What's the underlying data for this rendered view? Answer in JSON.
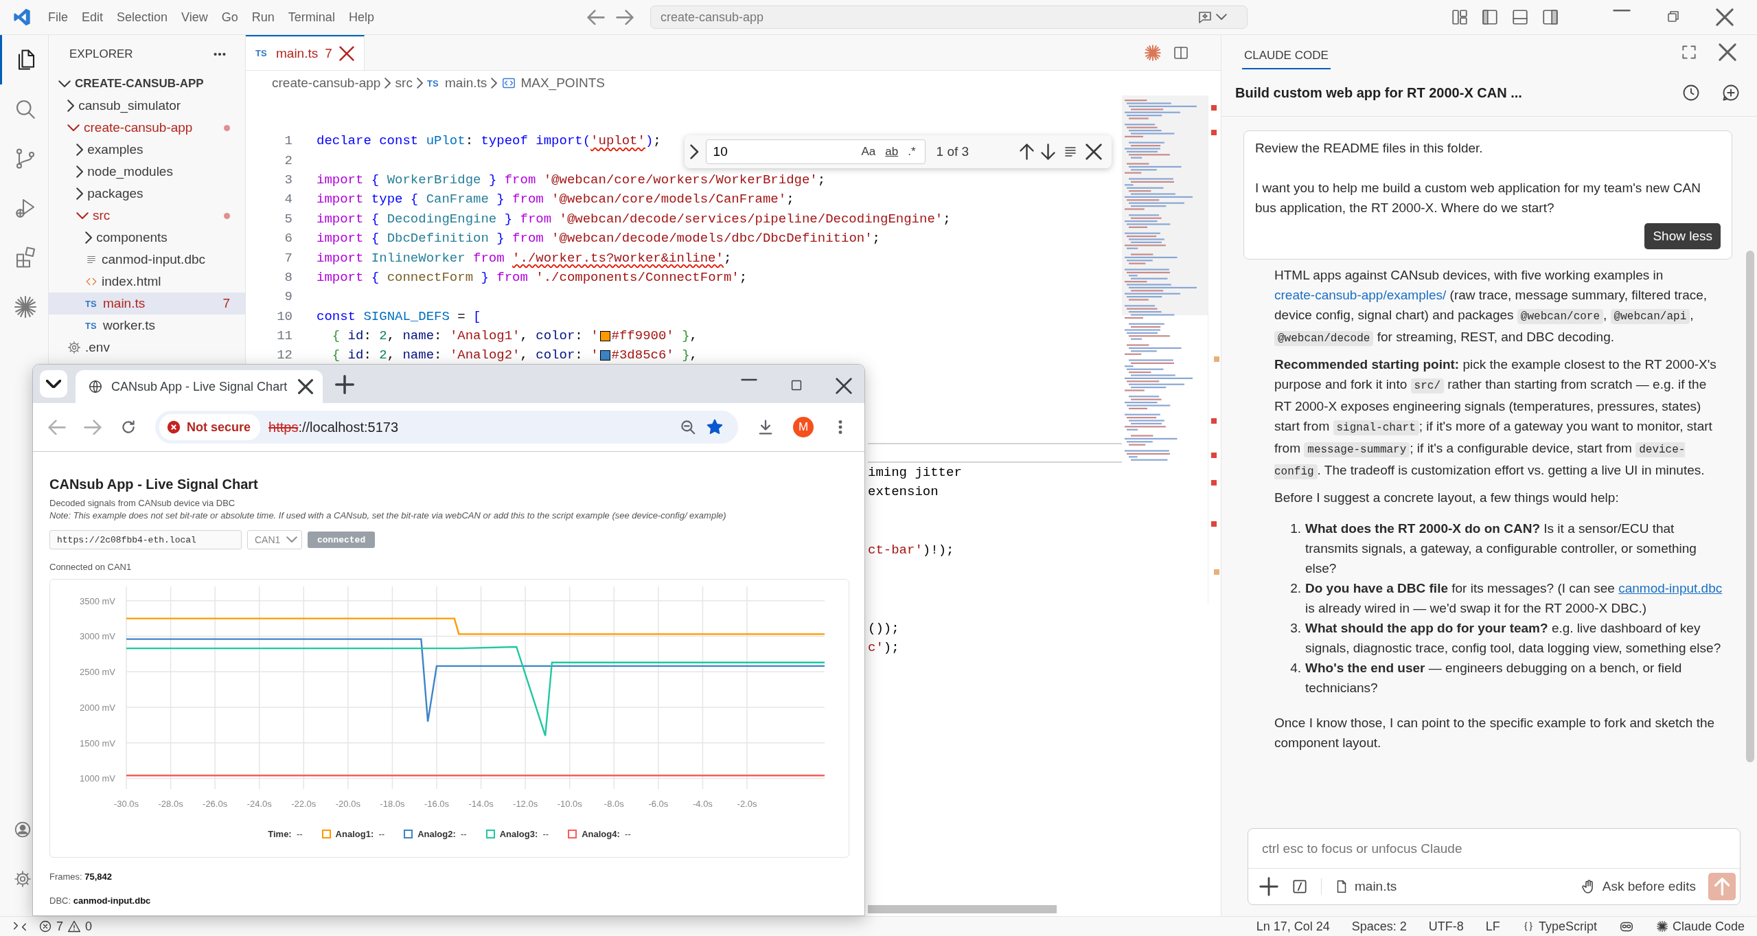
{
  "title_bar": {
    "menu": [
      "File",
      "Edit",
      "Selection",
      "View",
      "Go",
      "Run",
      "Terminal",
      "Help"
    ],
    "command_center": "create-cansub-app"
  },
  "activity_bar": [
    {
      "kind": "files",
      "selected": true
    },
    {
      "kind": "search",
      "selected": false
    },
    {
      "kind": "source_control",
      "selected": false
    },
    {
      "kind": "run_debug",
      "selected": false
    },
    {
      "kind": "extensions",
      "selected": false
    },
    {
      "kind": "claude",
      "selected": false
    }
  ],
  "activity_bar_bottom": [
    {
      "kind": "account"
    },
    {
      "kind": "settings"
    }
  ],
  "explorer": {
    "title": "EXPLORER",
    "tree": [
      {
        "label": "CREATE-CANSUB-APP",
        "kind": "root",
        "expanded": true,
        "selected": false,
        "error": false,
        "children": [
          {
            "label": "cansub_simulator",
            "kind": "folder",
            "expanded": false,
            "selected": false,
            "error": false
          },
          {
            "label": "create-cansub-app",
            "kind": "folder",
            "expanded": true,
            "selected": false,
            "error": true,
            "children": [
              {
                "label": "examples",
                "kind": "folder",
                "expanded": false,
                "selected": false,
                "error": false
              },
              {
                "label": "node_modules",
                "kind": "folder",
                "expanded": false,
                "selected": false,
                "error": false
              },
              {
                "label": "packages",
                "kind": "folder",
                "expanded": false,
                "selected": false,
                "error": false
              },
              {
                "label": "src",
                "kind": "folder",
                "expanded": true,
                "selected": false,
                "error": true,
                "children": [
                  {
                    "label": "components",
                    "kind": "folder",
                    "expanded": false,
                    "selected": false,
                    "error": false
                  },
                  {
                    "label": "canmod-input.dbc",
                    "kind": "text_file",
                    "selected": false,
                    "error": false
                  },
                  {
                    "label": "index.html",
                    "kind": "html_file",
                    "selected": false,
                    "error": false
                  },
                  {
                    "label": "main.ts",
                    "kind": "ts_file",
                    "tag": "TS",
                    "badge": "7",
                    "selected": true,
                    "error": true
                  },
                  {
                    "label": "worker.ts",
                    "kind": "ts_file",
                    "tag": "TS",
                    "selected": false,
                    "error": false
                  }
                ]
              }
            ]
          },
          {
            "label": ".env",
            "kind": "config_file",
            "selected": false,
            "error": false
          }
        ]
      }
    ]
  },
  "editor": {
    "tabs": [
      {
        "tag": "TS",
        "label": "main.ts",
        "badge": "7",
        "selected": true
      }
    ],
    "breadcrumbs": [
      {
        "kind": "folder",
        "label": "create-cansub-app"
      },
      {
        "kind": "folder",
        "label": "src"
      },
      {
        "kind": "ts_file",
        "tag": "TS",
        "label": "main.ts"
      },
      {
        "kind": "symbol",
        "label": "MAX_POINTS"
      }
    ],
    "find": {
      "value": "10",
      "options": [
        {
          "label": "Aa",
          "on": false
        },
        {
          "label": "ab",
          "on": false
        },
        {
          "label": ".*",
          "on": false
        }
      ],
      "result": "1 of 3"
    },
    "lines": [
      {
        "n": "1",
        "current": false,
        "tokens": [
          {
            "kind": "kw",
            "text": "declare const "
          },
          {
            "kind": "var",
            "text": "uPlot"
          },
          {
            "kind": "p",
            "text": ": "
          },
          {
            "kind": "kw",
            "text": "typeof import"
          },
          {
            "kind": "br",
            "text": "("
          },
          {
            "kind": "str",
            "text": "'uplot'",
            "squiggle": true
          },
          {
            "kind": "br",
            "text": ")"
          },
          {
            "kind": "p",
            "text": ";"
          }
        ]
      },
      {
        "n": "2",
        "current": false
      },
      {
        "n": "3",
        "current": false,
        "tokens": [
          {
            "kind": "ctl",
            "text": "import "
          },
          {
            "kind": "br",
            "text": "{ "
          },
          {
            "kind": "cls",
            "text": "WorkerBridge "
          },
          {
            "kind": "br",
            "text": "} "
          },
          {
            "kind": "ctl",
            "text": "from "
          },
          {
            "kind": "str",
            "text": "'@webcan/core/workers/WorkerBridge'"
          },
          {
            "kind": "p",
            "text": ";"
          }
        ]
      },
      {
        "n": "4",
        "current": false,
        "tokens": [
          {
            "kind": "ctl",
            "text": "import "
          },
          {
            "kind": "kw",
            "text": "type "
          },
          {
            "kind": "br",
            "text": "{ "
          },
          {
            "kind": "cls",
            "text": "CanFrame "
          },
          {
            "kind": "br",
            "text": "} "
          },
          {
            "kind": "ctl",
            "text": "from "
          },
          {
            "kind": "str",
            "text": "'@webcan/core/models/CanFrame'"
          },
          {
            "kind": "p",
            "text": ";"
          }
        ]
      },
      {
        "n": "5",
        "current": false,
        "tokens": [
          {
            "kind": "ctl",
            "text": "import "
          },
          {
            "kind": "br",
            "text": "{ "
          },
          {
            "kind": "cls",
            "text": "DecodingEngine "
          },
          {
            "kind": "br",
            "text": "} "
          },
          {
            "kind": "ctl",
            "text": "from "
          },
          {
            "kind": "str",
            "text": "'@webcan/decode/services/pipeline/DecodingEngine'"
          },
          {
            "kind": "p",
            "text": ";"
          }
        ]
      },
      {
        "n": "6",
        "current": false,
        "tokens": [
          {
            "kind": "ctl",
            "text": "import "
          },
          {
            "kind": "br",
            "text": "{ "
          },
          {
            "kind": "cls",
            "text": "DbcDefinition "
          },
          {
            "kind": "br",
            "text": "} "
          },
          {
            "kind": "ctl",
            "text": "from "
          },
          {
            "kind": "str",
            "text": "'@webcan/decode/models/dbc/DbcDefinition'"
          },
          {
            "kind": "p",
            "text": ";"
          }
        ]
      },
      {
        "n": "7",
        "current": false,
        "tokens": [
          {
            "kind": "ctl",
            "text": "import "
          },
          {
            "kind": "cls",
            "text": "InlineWorker "
          },
          {
            "kind": "ctl",
            "text": "from "
          },
          {
            "kind": "str",
            "text": "'./worker.ts?worker&inline'",
            "squiggle": true
          },
          {
            "kind": "p",
            "text": ";"
          }
        ]
      },
      {
        "n": "8",
        "current": false,
        "tokens": [
          {
            "kind": "ctl",
            "text": "import "
          },
          {
            "kind": "br",
            "text": "{ "
          },
          {
            "kind": "fn",
            "text": "connectForm "
          },
          {
            "kind": "br",
            "text": "} "
          },
          {
            "kind": "ctl",
            "text": "from "
          },
          {
            "kind": "str",
            "text": "'./components/ConnectForm'"
          },
          {
            "kind": "p",
            "text": ";"
          }
        ]
      },
      {
        "n": "9",
        "current": false
      },
      {
        "n": "10",
        "current": false,
        "tokens": [
          {
            "kind": "kw",
            "text": "const "
          },
          {
            "kind": "var",
            "text": "SIGNAL_DEFS"
          },
          {
            "kind": "p",
            "text": " = "
          },
          {
            "kind": "br",
            "text": "["
          }
        ]
      },
      {
        "n": "11",
        "current": false,
        "tokens": [
          {
            "kind": "br2",
            "text": "  { "
          },
          {
            "kind": "prop",
            "text": "id"
          },
          {
            "kind": "p",
            "text": ": "
          },
          {
            "kind": "num",
            "text": "2"
          },
          {
            "kind": "p",
            "text": ", "
          },
          {
            "kind": "prop",
            "text": "name"
          },
          {
            "kind": "p",
            "text": ": "
          },
          {
            "kind": "str",
            "text": "'Analog1'"
          },
          {
            "kind": "p",
            "text": ", "
          },
          {
            "kind": "prop",
            "text": "color"
          },
          {
            "kind": "p",
            "text": ": "
          },
          {
            "kind": "str",
            "text": "'"
          },
          {
            "kind": "swatch",
            "color": "#ff9900"
          },
          {
            "kind": "str",
            "text": "#ff9900'"
          },
          {
            "kind": "br2",
            "text": " }"
          },
          {
            "kind": "p",
            "text": ","
          }
        ]
      },
      {
        "n": "12",
        "current": false,
        "tokens": [
          {
            "kind": "br2",
            "text": "  { "
          },
          {
            "kind": "prop",
            "text": "id"
          },
          {
            "kind": "p",
            "text": ": "
          },
          {
            "kind": "num",
            "text": "2"
          },
          {
            "kind": "p",
            "text": ", "
          },
          {
            "kind": "prop",
            "text": "name"
          },
          {
            "kind": "p",
            "text": ": "
          },
          {
            "kind": "str",
            "text": "'Analog2'"
          },
          {
            "kind": "p",
            "text": ", "
          },
          {
            "kind": "prop",
            "text": "color"
          },
          {
            "kind": "p",
            "text": ": "
          },
          {
            "kind": "str",
            "text": "'"
          },
          {
            "kind": "swatch",
            "color": "#3d85c6"
          },
          {
            "kind": "str",
            "text": "#3d85c6'"
          },
          {
            "kind": "br2",
            "text": " }"
          },
          {
            "kind": "p",
            "text": ","
          }
        ]
      }
    ],
    "covered_lines": [
      {
        "kind": "blank",
        "current": false
      },
      {
        "kind": "blank",
        "current": false
      },
      {
        "kind": "blank",
        "current": false
      },
      {
        "kind": "blank",
        "current": false
      },
      {
        "kind": "blank",
        "current": true
      },
      {
        "kind": "code",
        "current": false,
        "tokens": [
          {
            "kind": "p",
            "text": "iming jitter"
          }
        ]
      },
      {
        "kind": "code",
        "current": false,
        "tokens": [
          {
            "kind": "p",
            "text": "extension"
          }
        ]
      },
      {
        "kind": "blank",
        "current": false
      },
      {
        "kind": "blank",
        "current": false
      },
      {
        "kind": "code",
        "current": false,
        "tokens": [
          {
            "kind": "str",
            "text": "ct-bar'"
          },
          {
            "kind": "p",
            "text": ")!);"
          }
        ]
      },
      {
        "kind": "blank",
        "current": false
      },
      {
        "kind": "blank",
        "current": false
      },
      {
        "kind": "blank",
        "current": false
      },
      {
        "kind": "code",
        "current": false,
        "tokens": [
          {
            "kind": "p",
            "text": "());"
          }
        ]
      },
      {
        "kind": "code",
        "current": false,
        "tokens": [
          {
            "kind": "str",
            "text": "c'"
          },
          {
            "kind": "p",
            "text": ");"
          }
        ]
      }
    ]
  },
  "browser": {
    "tab": {
      "title": "CANsub App - Live Signal Chart"
    },
    "security": "Not secure",
    "url": {
      "scheme": "https",
      "rest": "://localhost:5173"
    },
    "bookmarked": true,
    "avatar": "M",
    "page": {
      "title": "CANsub App - Live Signal Chart",
      "subtitle": "Decoded signals from CANsub device via DBC",
      "note": "Note: This example does not set bit-rate or absolute time. If used with a CANsub, set the bit-rate via webCAN or add this to the script example (see device-config/ example)",
      "host": "https://2c08fbb4-eth.local",
      "channel": "CAN1",
      "status_button": "connected",
      "status": "Connected on CAN1",
      "chart_data": {
        "type": "line",
        "grid": true,
        "x": [
          -30,
          -16.7,
          -16.4,
          -16.0,
          -15.2,
          -15.0,
          -12.4,
          -11.1,
          -10.8,
          1.5
        ],
        "series": [
          {
            "color": "#ff9900",
            "values": [
              3250,
              3250,
              3250,
              3250,
              3250,
              3030,
              3030,
              3030,
              3030,
              3030
            ]
          },
          {
            "color": "#3d85c6",
            "values": [
              2960,
              2960,
              1800,
              2580,
              2580,
              2580,
              2580,
              2580,
              2580,
              2580
            ]
          },
          {
            "color": "#1fc8a0",
            "values": [
              2830,
              2830,
              2830,
              2830,
              2830,
              2830,
              2850,
              1600,
              2630,
              2630
            ]
          },
          {
            "color": "#ff5a5a",
            "values": [
              1040,
              1040,
              1040,
              1040,
              1040,
              1040,
              1040,
              1040,
              1040,
              1040
            ]
          }
        ],
        "xlim": [
          -30,
          1.5
        ],
        "ylim": [
          850,
          3700
        ],
        "xticks": [
          {
            "value": -30,
            "label": "-30.0s"
          },
          {
            "value": -28,
            "label": "-28.0s"
          },
          {
            "value": -26,
            "label": "-26.0s"
          },
          {
            "value": -24,
            "label": "-24.0s"
          },
          {
            "value": -22,
            "label": "-22.0s"
          },
          {
            "value": -20,
            "label": "-20.0s"
          },
          {
            "value": -18,
            "label": "-18.0s"
          },
          {
            "value": -16,
            "label": "-16.0s"
          },
          {
            "value": -14,
            "label": "-14.0s"
          },
          {
            "value": -12,
            "label": "-12.0s"
          },
          {
            "value": -10,
            "label": "-10.0s"
          },
          {
            "value": -8,
            "label": "-8.0s"
          },
          {
            "value": -6,
            "label": "-6.0s"
          },
          {
            "value": -4,
            "label": "-4.0s"
          },
          {
            "value": -2,
            "label": "-2.0s"
          }
        ],
        "yticks": [
          {
            "value": 1000,
            "label": "1000 mV"
          },
          {
            "value": 1500,
            "label": "1500 mV"
          },
          {
            "value": 2000,
            "label": "2000 mV"
          },
          {
            "value": 2500,
            "label": "2500 mV"
          },
          {
            "value": 3000,
            "label": "3000 mV"
          },
          {
            "value": 3500,
            "label": "3500 mV"
          }
        ]
      },
      "legend": [
        {
          "kind": "time",
          "label": "Time:",
          "value": "--"
        },
        {
          "kind": "series",
          "label": "Analog1:",
          "value": "--",
          "color": "#ff9900"
        },
        {
          "kind": "series",
          "label": "Analog2:",
          "value": "--",
          "color": "#3d85c6"
        },
        {
          "kind": "series",
          "label": "Analog3:",
          "value": "--",
          "color": "#1fc8a0"
        },
        {
          "kind": "series",
          "label": "Analog4:",
          "value": "--",
          "color": "#ff5a5a"
        }
      ],
      "frames": "Frames: **75,842**",
      "dbc": "DBC: **canmod-input.dbc**"
    }
  },
  "claude": {
    "tab": "CLAUDE CODE",
    "title": "Build custom web app for RT 2000-X CAN ...",
    "user_message": [
      "Review the README files in this folder.",
      "I want you to help me build a custom web application for my team's new CAN bus application, the RT 2000-X. Where do we start?"
    ],
    "show_less": "Show less",
    "response": [
      {
        "kind": "paragraph",
        "segments": [
          {
            "kind": "text",
            "text": "HTML apps against CANsub devices, with five working examples in "
          },
          {
            "kind": "link",
            "text": "create-cansub-app/examples/",
            "underlined": false
          },
          {
            "kind": "text",
            "text": " (raw trace, message summary, filtered trace, device config, signal chart) and packages "
          },
          {
            "kind": "code",
            "text": "@webcan/core"
          },
          {
            "kind": "text",
            "text": ", "
          },
          {
            "kind": "code",
            "text": "@webcan/api"
          },
          {
            "kind": "text",
            "text": ", "
          },
          {
            "kind": "code",
            "text": "@webcan/decode"
          },
          {
            "kind": "text",
            "text": " for streaming, REST, and DBC decoding."
          }
        ]
      },
      {
        "kind": "paragraph",
        "segments": [
          {
            "kind": "bold",
            "text": "Recommended starting point:"
          },
          {
            "kind": "text",
            "text": " pick the example closest to the RT 2000-X's purpose and fork it into "
          },
          {
            "kind": "code",
            "text": "src/"
          },
          {
            "kind": "text",
            "text": " rather than starting from scratch — e.g. if the RT 2000-X exposes engineering signals (temperatures, pressures, states) start from "
          },
          {
            "kind": "code",
            "text": "signal-chart"
          },
          {
            "kind": "text",
            "text": "; if it's more of a gateway you want to monitor, start from "
          },
          {
            "kind": "code",
            "text": "message-summary"
          },
          {
            "kind": "text",
            "text": "; if it's a configurable device, start from "
          },
          {
            "kind": "code",
            "text": "device-config"
          },
          {
            "kind": "text",
            "text": ". The tradeoff is customization effort vs. getting a live UI in minutes."
          }
        ]
      },
      {
        "kind": "paragraph",
        "segments": [
          {
            "kind": "text",
            "text": "Before I suggest a concrete layout, a few things would help:"
          }
        ]
      },
      {
        "kind": "list",
        "items": [
          {
            "number": "1.",
            "segments": [
              {
                "kind": "bold",
                "text": "What does the RT 2000-X do on CAN?"
              },
              {
                "kind": "text",
                "text": " Is it a sensor/ECU that transmits signals, a gateway, a configurable controller, or something else?"
              }
            ]
          },
          {
            "number": "2.",
            "segments": [
              {
                "kind": "bold",
                "text": "Do you have a DBC file"
              },
              {
                "kind": "text",
                "text": " for its messages? (I can see "
              },
              {
                "kind": "link",
                "text": "canmod-input.dbc",
                "underlined": true
              },
              {
                "kind": "text",
                "text": " is already wired in — we'd swap it for the RT 2000-X DBC.)"
              }
            ]
          },
          {
            "number": "3.",
            "segments": [
              {
                "kind": "bold",
                "text": "What should the app do for your team?"
              },
              {
                "kind": "text",
                "text": " e.g. live dashboard of key signals, diagnostic trace, config tool, data logging view, something else?"
              }
            ]
          },
          {
            "number": "4.",
            "segments": [
              {
                "kind": "bold",
                "text": "Who's the end user"
              },
              {
                "kind": "text",
                "text": " — engineers debugging on a bench, or field technicians?"
              }
            ]
          }
        ]
      },
      {
        "kind": "paragraph",
        "segments": [
          {
            "kind": "text",
            "text": "Once I know those, I can point to the specific example to fork and sketch the component layout."
          }
        ]
      }
    ],
    "input": {
      "placeholder": "ctrl esc to focus or unfocus Claude",
      "file": "main.ts",
      "mode": "Ask before edits"
    }
  },
  "status_bar": {
    "errors": "7",
    "warnings": "0",
    "items": [
      {
        "kind": "text",
        "label": "Ln 17, Col 24"
      },
      {
        "kind": "text",
        "label": "Spaces: 2"
      },
      {
        "kind": "text",
        "label": "UTF-8"
      },
      {
        "kind": "text",
        "label": "LF"
      },
      {
        "kind": "language",
        "label": "TypeScript"
      },
      {
        "kind": "bot"
      },
      {
        "kind": "claude",
        "label": "Claude Code"
      }
    ]
  }
}
